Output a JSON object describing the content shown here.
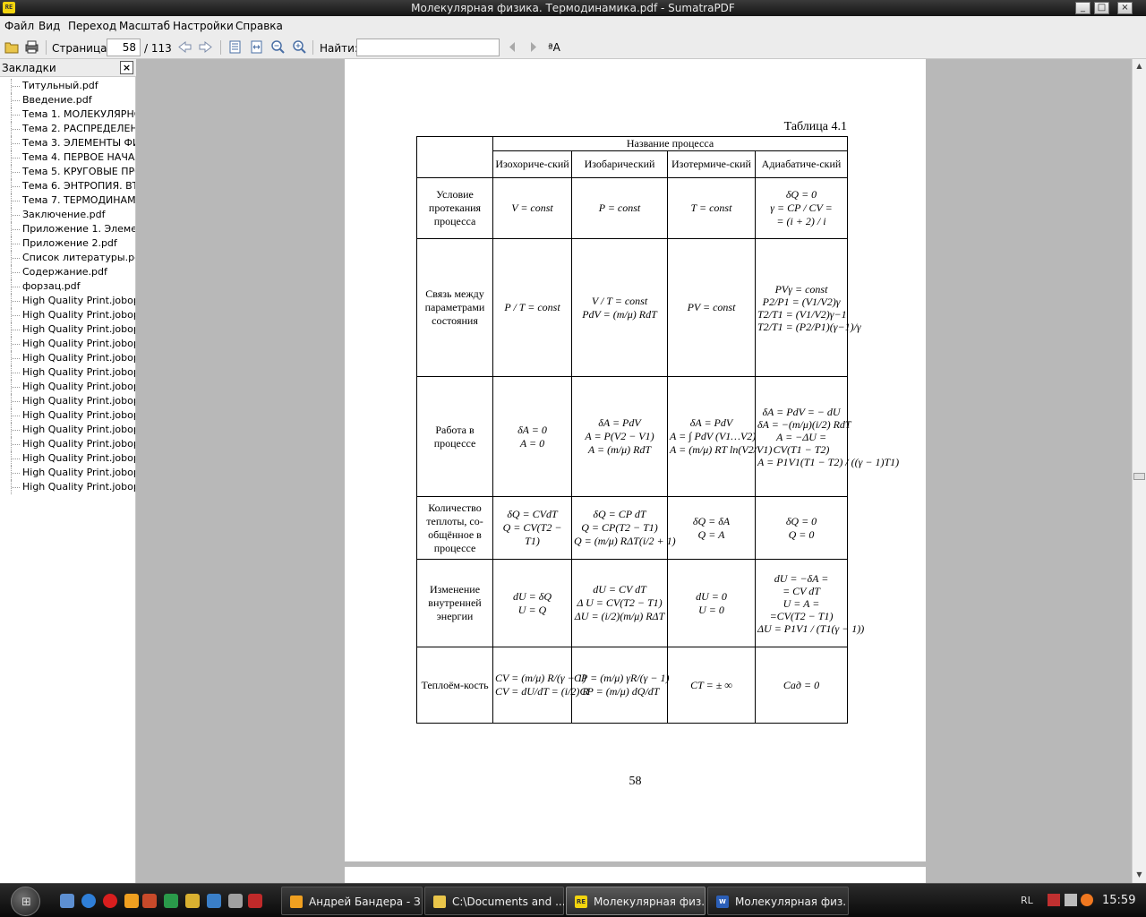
{
  "window": {
    "title": "Молекулярная физика. Термодинамика.pdf - SumatraPDF",
    "app_icon": "sumatra-icon",
    "app_icon_text": "RE",
    "controls": [
      "_",
      "□",
      "×"
    ]
  },
  "menu": [
    "Файл",
    "Вид",
    "Переход",
    "Масштаб",
    "Настройки",
    "Справка"
  ],
  "toolbar": {
    "page_label": "Страница:",
    "page_value": "58",
    "page_total": "/ 113",
    "find_label": "Найти:",
    "find_value": "",
    "match_case_label": "ªA"
  },
  "bookmarks": {
    "header": "Закладки",
    "close": "×",
    "items": [
      "Титульный.pdf",
      "Введение.pdf",
      "Тема 1. МОЛЕКУЛЯРНО-",
      "Тема 2. РАСПРЕДЕЛЕНИ",
      "Тема 3. ЭЛЕМЕНТЫ ФИЗ",
      "Тема 4. ПЕРВОЕ НАЧАЛО",
      "Тема 5.  КРУГОВЫЕ ПРО",
      "Тема 6. ЭНТРОПИЯ. ВТО",
      "Тема 7. ТЕРМОДИНАМИ",
      "Заключение.pdf",
      "Приложение 1. Элемен",
      "Приложение 2.pdf",
      "Список литературы.pdf",
      "Содержание.pdf",
      "форзац.pdf",
      "High Quality Print.jobop",
      "High Quality Print.jobop",
      "High Quality Print.jobop",
      "High Quality Print.jobop",
      "High Quality Print.jobop",
      "High Quality Print.jobop",
      "High Quality Print.jobop",
      "High Quality Print.jobop",
      "High Quality Print.jobop",
      "High Quality Print.jobop",
      "High Quality Print.jobop",
      "High Quality Print.jobop",
      "High Quality Print.jobop",
      "High Quality Print.jobop"
    ]
  },
  "document": {
    "caption": "Таблица 4.1",
    "header_group": "Название процесса",
    "columns": [
      "Изохориче-ский",
      "Изобарический",
      "Изотермиче-ский",
      "Адиабатиче-ский"
    ],
    "rows": [
      {
        "label": "Условие протекания процесса",
        "cells": [
          [
            "V = const"
          ],
          [
            "P = const"
          ],
          [
            "T = const"
          ],
          [
            "δQ = 0",
            "γ = CP / CV =",
            "= (i + 2) / i"
          ]
        ]
      },
      {
        "label": "Связь между параметрами состояния",
        "cells": [
          [
            "P / T = const"
          ],
          [
            "V / T = const",
            "PdV = (m/μ) RdT"
          ],
          [
            "PV = const"
          ],
          [
            "PVγ = const",
            "P2/P1 = (V1/V2)γ",
            "T2/T1 = (V1/V2)γ−1",
            "T2/T1 = (P2/P1)(γ−1)/γ"
          ]
        ]
      },
      {
        "label": "Работа в процессе",
        "cells": [
          [
            "δA = 0",
            "A = 0"
          ],
          [
            "δA = PdV",
            "A = P(V2 − V1)",
            "A = (m/μ) RdT"
          ],
          [
            "δA = PdV",
            "A = ∫ PdV (V1…V2)",
            "A = (m/μ) RT ln(V2/V1)"
          ],
          [
            "δA = PdV = − dU",
            "δA = −(m/μ)(i/2) RdT",
            "A = −ΔU =",
            "CV(T1 − T2)",
            "A = P1V1(T1 − T2) / ((γ − 1)T1)"
          ]
        ]
      },
      {
        "label": "Количество теплоты, со-общённое в процессе",
        "cells": [
          [
            "δQ = CVdT",
            "Q = CV(T2 −",
            "T1)"
          ],
          [
            "δQ = CP dT",
            "Q = CP(T2 − T1)",
            "Q = (m/μ) RΔT(i/2 + 1)"
          ],
          [
            "δQ = δA",
            "Q = A"
          ],
          [
            "δQ = 0",
            "Q = 0"
          ]
        ]
      },
      {
        "label": "Изменение внутренней энергии",
        "cells": [
          [
            "dU = δQ",
            "U = Q"
          ],
          [
            "dU = CV dT",
            "Δ U = CV(T2 − T1)",
            "ΔU = (i/2)(m/μ) RΔT"
          ],
          [
            "dU = 0",
            "U = 0"
          ],
          [
            "dU = −δA =",
            "= CV dT",
            "U = A =",
            "=CV(T2 − T1)",
            "ΔU = P1V1 / (T1(γ − 1))"
          ]
        ]
      },
      {
        "label": "Теплоём-кость",
        "cells": [
          [
            "CV = (m/μ) R/(γ − 1)",
            "CV = dU/dT = (i/2) R"
          ],
          [
            "CP = (m/μ) γR/(γ − 1)",
            "CP = (m/μ) dQ/dT"
          ],
          [
            "CT = ± ∞"
          ],
          [
            "Cад = 0"
          ]
        ]
      }
    ],
    "page_number": "58"
  },
  "taskbar": {
    "tasks": [
      {
        "label": "Андрей Бандера - З...",
        "icon": "aimp-icon",
        "active": false
      },
      {
        "label": "C:\\Documents and ...",
        "icon": "folder-icon",
        "active": false
      },
      {
        "label": "Молекулярная физ...",
        "icon": "sumatra-icon",
        "active": true
      },
      {
        "label": "Молекулярная физ...",
        "icon": "word-icon",
        "active": false
      }
    ],
    "lang": "RL",
    "clock": "15:59"
  },
  "colors": {
    "accent": "#f2d40e",
    "canvas": "#b8b8b8",
    "taskbar": "#141414"
  }
}
